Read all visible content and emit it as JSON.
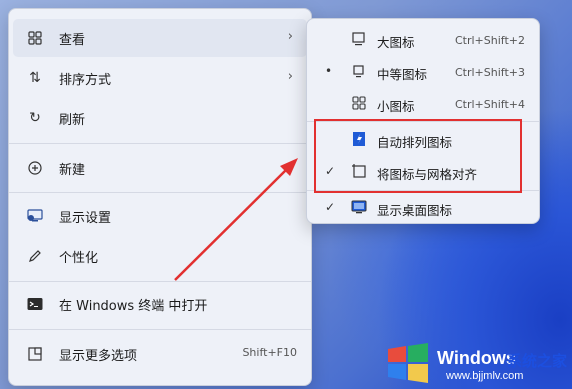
{
  "context_menu": {
    "items": [
      {
        "label": "查看",
        "icon": "grid-icon",
        "has_submenu": true
      },
      {
        "label": "排序方式",
        "icon": "sort-arrows-icon",
        "has_submenu": true
      },
      {
        "label": "刷新",
        "icon": "refresh-icon"
      },
      {
        "label": "新建",
        "icon": "plus-circle-icon",
        "has_submenu": true
      },
      {
        "label": "显示设置",
        "icon": "display-icon"
      },
      {
        "label": "个性化",
        "icon": "pen-icon"
      },
      {
        "label": "在 Windows 终端 中打开",
        "icon": "terminal-icon"
      },
      {
        "label": "显示更多选项",
        "icon": "more-options-icon",
        "shortcut": "Shift+F10"
      }
    ]
  },
  "view_submenu": {
    "items": [
      {
        "label": "大图标",
        "icon": "large-icon-icon",
        "shortcut": "Ctrl+Shift+2",
        "mark": ""
      },
      {
        "label": "中等图标",
        "icon": "medium-icon-icon",
        "shortcut": "Ctrl+Shift+3",
        "mark": "•"
      },
      {
        "label": "小图标",
        "icon": "small-icon-icon",
        "shortcut": "Ctrl+Shift+4",
        "mark": ""
      },
      {
        "label": "自动排列图标",
        "icon": "auto-arrange-icon",
        "mark": ""
      },
      {
        "label": "将图标与网格对齐",
        "icon": "align-grid-icon",
        "mark": "✓"
      },
      {
        "label": "显示桌面图标",
        "icon": "show-desktop-icon",
        "mark": "✓"
      }
    ]
  },
  "colors": {
    "annotation_red": "#e23030",
    "menu_bg": "#eef1f8",
    "brand_blue": "#1c4fe0"
  },
  "watermark": {
    "brand": "Windows",
    "site": "系统之家",
    "url": "www.bjjmlv.com"
  }
}
